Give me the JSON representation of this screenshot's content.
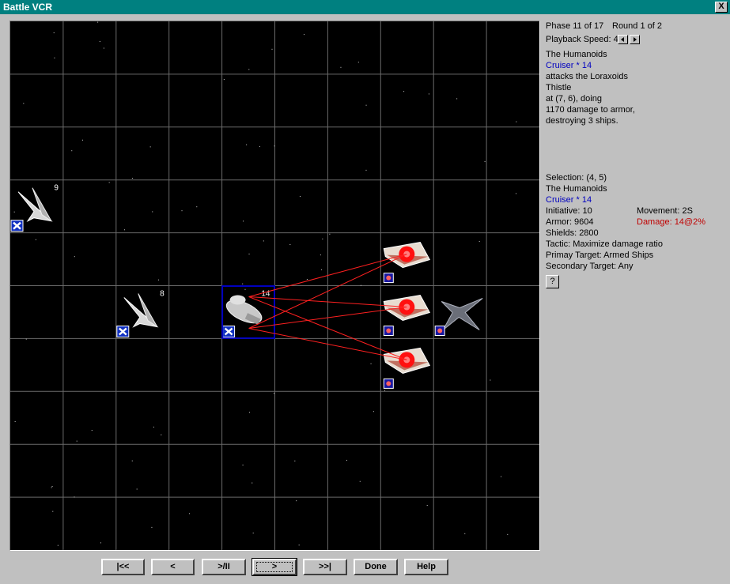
{
  "window": {
    "title": "Battle VCR",
    "close_label": "X"
  },
  "colors": {
    "titlebar": "#008080",
    "selection": "#0000c0",
    "laser": "#ff2020",
    "race_blue": "#0000c0",
    "damage_red": "#c00000"
  },
  "status": {
    "phase": "Phase 11 of 17",
    "round": "Round 1 of 2",
    "playback_label": "Playback Speed: 4",
    "event": {
      "attacker_race": "The Humanoids",
      "attacker_ship": "Cruiser * 14",
      "action": "attacks the Loraxoids",
      "target": "Thistle",
      "location": "at (7, 6), doing",
      "damage": "1170 damage to armor,",
      "result": "destroying 3 ships."
    }
  },
  "selection": {
    "label": "Selection:  (4, 5)",
    "race": "The Humanoids",
    "ship": "Cruiser * 14",
    "initiative": "Initiative: 10",
    "movement": "Movement: 2S",
    "armor": "Armor: 9604",
    "damage": "Damage: 14@2%",
    "shields": "Shields: 2800",
    "tactic": "Tactic: Maximize damage ratio",
    "primary_target": "Primay Target: Armed Ships",
    "secondary_target": "Secondary Target: Any",
    "help_label": "?"
  },
  "grid": {
    "size": 10,
    "tokens": [
      {
        "col": 1,
        "row": 4,
        "kind": "fighter",
        "count": "9",
        "icon": "fighter-ship-icon"
      },
      {
        "col": 3,
        "row": 6,
        "kind": "fighter",
        "count": "8",
        "icon": "fighter-ship-icon"
      },
      {
        "col": 5,
        "row": 6,
        "kind": "cruiser",
        "count": "14",
        "icon": "cruiser-ship-icon",
        "selected": true
      },
      {
        "col": 8,
        "row": 5,
        "kind": "enemy-hit",
        "count": "",
        "icon": "exploding-ship-icon"
      },
      {
        "col": 8,
        "row": 6,
        "kind": "enemy-hit",
        "count": "",
        "icon": "exploding-ship-icon"
      },
      {
        "col": 8,
        "row": 7,
        "kind": "enemy-hit",
        "count": "",
        "icon": "exploding-ship-icon"
      },
      {
        "col": 9,
        "row": 6,
        "kind": "station",
        "count": "",
        "icon": "battle-station-icon"
      }
    ],
    "attacks": [
      {
        "from": [
          5,
          6
        ],
        "to": [
          8,
          5
        ]
      },
      {
        "from": [
          5,
          6
        ],
        "to": [
          8,
          6
        ]
      },
      {
        "from": [
          5,
          6
        ],
        "to": [
          8,
          7
        ]
      }
    ]
  },
  "controls": {
    "first": "|<<",
    "prev": "<",
    "play_pause": ">/II",
    "next": ">",
    "last": ">>|",
    "done": "Done",
    "help": "Help"
  }
}
